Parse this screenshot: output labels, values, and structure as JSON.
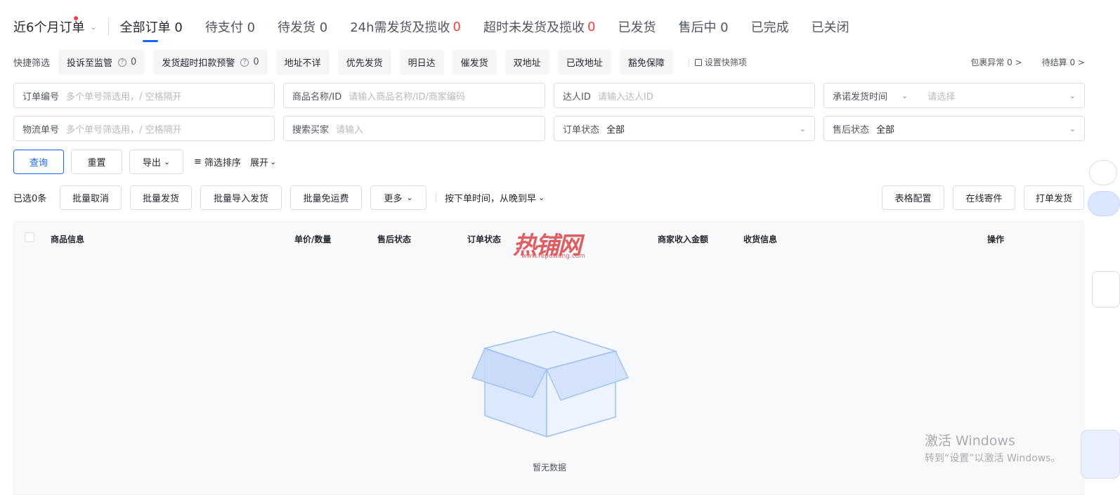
{
  "tabs": {
    "period": "近6个月订单",
    "items": [
      {
        "label": "全部订单 0",
        "count": ""
      },
      {
        "label": "待支付 0",
        "count": ""
      },
      {
        "label": "待发货 0",
        "count": ""
      },
      {
        "label": "24h需发货及揽收",
        "count": "0"
      },
      {
        "label": "超时未发货及揽收",
        "count": "0"
      },
      {
        "label": "已发货",
        "count": ""
      },
      {
        "label": "售后中 0",
        "count": ""
      },
      {
        "label": "已完成",
        "count": ""
      },
      {
        "label": "已关闭",
        "count": ""
      }
    ]
  },
  "quick_filter": {
    "label": "快捷筛选",
    "chips": [
      {
        "label": "投诉至监管",
        "help": "?",
        "count": "0"
      },
      {
        "label": "发货超时扣款预警",
        "help": "?",
        "count": "0"
      },
      {
        "label": "地址不详"
      },
      {
        "label": "优先发货"
      },
      {
        "label": "明日达"
      },
      {
        "label": "催发货"
      },
      {
        "label": "双地址"
      },
      {
        "label": "已改地址"
      },
      {
        "label": "豁免保障"
      }
    ],
    "set_quick": "设置快筛项",
    "stats": [
      "包裹异常 0 >",
      "待结算 0 >"
    ]
  },
  "search": {
    "order_no": {
      "label": "订单编号",
      "placeholder": "多个单号筛选用，/ 空格隔开"
    },
    "product": {
      "label": "商品名称/ID",
      "placeholder": "请输入商品名称/ID/商家编码"
    },
    "influencer": {
      "label": "达人ID",
      "placeholder": "请输入达人ID"
    },
    "ship_time": {
      "label": "承诺发货时间",
      "placeholder": "请选择"
    },
    "logistics_no": {
      "label": "物流单号",
      "placeholder": "多个单号筛选用，/ 空格隔开"
    },
    "buyer": {
      "label": "搜索买家",
      "placeholder": "请输入"
    },
    "order_status": {
      "label": "订单状态",
      "value": "全部"
    },
    "aftersale_status": {
      "label": "售后状态",
      "value": "全部"
    }
  },
  "actions": {
    "query": "查询",
    "reset": "重置",
    "export": "导出",
    "sort_filter": "筛选排序",
    "expand": "展开"
  },
  "batch": {
    "selected": "已选0条",
    "cancel": "批量取消",
    "ship": "批量发货",
    "import_ship": "批量导入发货",
    "free_shipping": "批量免运费",
    "more": "更多",
    "sort": "按下单时间，从晚到早",
    "table_config": "表格配置",
    "online_send": "在线寄件",
    "print_ship": "打单发货"
  },
  "table": {
    "headers": [
      "商品信息",
      "单价/数量",
      "售后状态",
      "订单状态",
      "商家收入金额",
      "收货信息",
      "操作"
    ],
    "empty_text": "暂无数据"
  },
  "watermark": {
    "logo": "热铺网",
    "url": "www.repuwang.com"
  },
  "windows": {
    "line1": "激活 Windows",
    "line2": "转到“设置”以激活 Windows。"
  }
}
